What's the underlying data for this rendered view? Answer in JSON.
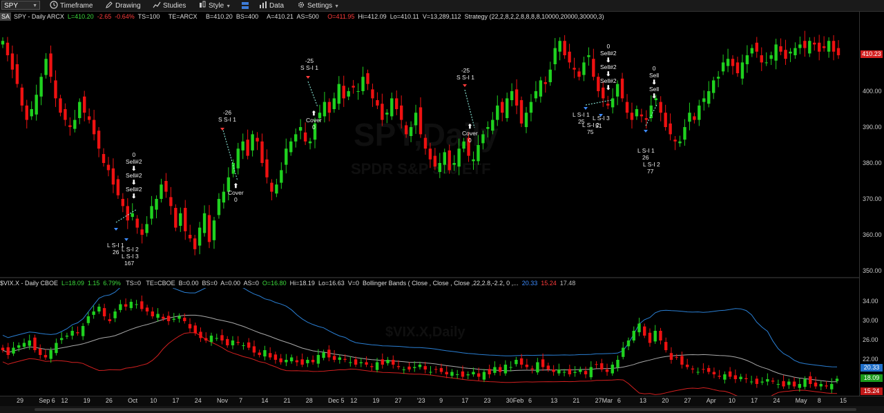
{
  "toolbar": {
    "symbol": "SPY",
    "timeframe": "Timeframe",
    "drawing": "Drawing",
    "studies": "Studies",
    "style": "Style",
    "data": "Data",
    "settings": "Settings"
  },
  "price_header": {
    "badge": "SA",
    "symbol": "SPY - Daily  ARCX",
    "last": "L=410.20",
    "chg": "-2.65",
    "pct": "-0.64%",
    "ts": "TS=100",
    "te": "TE=ARCX",
    "bid": "B=410.20",
    "bs": "BS=400",
    "ask": "A=410.21",
    "as": "AS=500",
    "open": "O=411.95",
    "high": "Hi=412.09",
    "low": "Lo=410.11",
    "vol": "V=13,289,112",
    "strategy": "Strategy (22,2,8,2,2,8,8,8,8,10000,20000,30000,3)"
  },
  "vix_header": {
    "symbol": "$VIX.X - Daily  CBOE",
    "last": "L=18.09",
    "chg": "1.15",
    "pct": "6.79%",
    "ts": "TS=0",
    "te": "TE=CBOE",
    "bid": "B=0.00",
    "bs": "BS=0",
    "ask": "A=0.00",
    "as": "AS=0",
    "open": "O=16.80",
    "high": "Hi=18.19",
    "low": "Lo=16.63",
    "vol": "V=0",
    "study": "Bollinger Bands ( Close , Close , Close ,22,2.8,-2.2, 0 ,...",
    "bb_upper": "20.33",
    "bb_lower": "15.24",
    "bb_mid": "17.48"
  },
  "watermarks": {
    "spy_title": "SPY,Daily",
    "spy_sub": "SPDR S&P 500 ETF",
    "vix_title": "$VIX.X,Daily"
  },
  "price_axis": [
    "400.00",
    "390.00",
    "380.00",
    "370.00",
    "360.00",
    "350.00"
  ],
  "price_tag": "410.23",
  "vix_axis": [
    "34.00",
    "30.00",
    "26.00",
    "22.00"
  ],
  "vix_tags": {
    "upper": "20.33",
    "last": "18.09",
    "lower": "15.24"
  },
  "date_axis": [
    "29",
    "Sep 6",
    "12",
    "19",
    "26",
    "Oct",
    "10",
    "17",
    "24",
    "Nov",
    "7",
    "14",
    "21",
    "28",
    "Dec 5",
    "12",
    "19",
    "27",
    "'23",
    "9",
    "17",
    "23",
    "30Feb",
    "6",
    "13",
    "21",
    "27Mar",
    "6",
    "13",
    "20",
    "27",
    "Apr",
    "10",
    "17",
    "24",
    "May",
    "8",
    "15"
  ],
  "annotations": {
    "a1": [
      "0",
      "Sell#2",
      "Sell#2",
      "Sell#2"
    ],
    "a1b": [
      "L S-I 1",
      "26",
      "L S-I 2",
      "83",
      "L S-I 3",
      "167"
    ],
    "a2": [
      "-26",
      "S S-I 1"
    ],
    "a2b": [
      "Cover",
      "0"
    ],
    "a3": [
      "-25",
      "S S-I 1"
    ],
    "a3b": [
      "Cover",
      "0"
    ],
    "a4": [
      "-25",
      "S S-I 1"
    ],
    "a4b": [
      "Cover",
      "0"
    ],
    "a5": [
      "0",
      "Sell#2",
      "Sell#2",
      "Sell#2"
    ],
    "a5b": [
      "L S-I 1",
      "25",
      "L S-I 3",
      "L S-I 2",
      "51",
      "75"
    ],
    "a6": [
      "0",
      "Sell",
      "Sell"
    ],
    "a6b": [
      "L S-I 1",
      "26",
      "L S-I 2",
      "77"
    ]
  },
  "colors": {
    "up": "#1fd11f",
    "down": "#ee1111",
    "bb_upper": "#2a7fd4",
    "bb_lower": "#d42020",
    "bb_mid": "#aaaaaa"
  },
  "spy_closes": [
    414,
    410,
    406,
    402,
    396,
    392,
    395,
    399,
    404,
    409,
    404,
    398,
    394,
    392,
    390,
    392,
    397,
    394,
    392,
    388,
    384,
    380,
    378,
    374,
    371,
    368,
    364,
    366,
    362,
    360,
    363,
    368,
    370,
    374,
    372,
    368,
    362,
    366,
    361,
    359,
    356,
    362,
    366,
    358,
    364,
    370,
    372,
    376,
    380,
    384,
    386,
    382,
    388,
    386,
    380,
    376,
    372,
    374,
    378,
    384,
    386,
    388,
    390,
    386,
    386,
    391,
    394,
    397,
    394,
    398,
    402,
    398,
    400,
    401,
    400,
    404,
    402,
    398,
    396,
    392,
    394,
    398,
    395,
    392,
    388,
    390,
    394,
    388,
    384,
    381,
    379,
    380,
    383,
    378,
    380,
    384,
    386,
    382,
    381,
    385,
    388,
    390,
    392,
    396,
    394,
    398,
    400,
    396,
    391,
    394,
    397,
    400,
    403,
    402,
    406,
    412,
    414,
    410,
    408,
    406,
    404,
    408,
    410,
    404,
    400,
    398,
    396,
    398,
    402,
    398,
    394,
    392,
    395,
    393,
    392,
    396,
    398,
    394,
    390,
    388,
    386,
    386,
    390,
    394,
    392,
    396,
    398,
    400,
    403,
    404,
    408,
    409,
    407,
    405,
    408,
    410,
    412,
    411,
    408,
    408,
    410,
    413,
    411,
    409,
    411,
    412,
    413,
    412,
    414,
    413,
    411,
    412,
    414,
    411,
    410
  ],
  "vix_closes": [
    24,
    23,
    24.5,
    25,
    25.5,
    26,
    24,
    23,
    22.5,
    24,
    25.5,
    26.5,
    27,
    28,
    27.5,
    29,
    31,
    32,
    33,
    31,
    30,
    32,
    33.5,
    33,
    34,
    33.5,
    32.5,
    32,
    31,
    31.5,
    30.5,
    30,
    30.5,
    31,
    30,
    28.5,
    27.5,
    26.5,
    26,
    27,
    26.5,
    26,
    25,
    26,
    25.5,
    25,
    24.5,
    23.5,
    23,
    24,
    22.5,
    22,
    21.5,
    22,
    22.5,
    21.5,
    21,
    22,
    21.5,
    23,
    23.5,
    22.5,
    22,
    22.5,
    22,
    21.5,
    21,
    21.5,
    21,
    20.5,
    21.5,
    21,
    22,
    21,
    20.5,
    20,
    20,
    20.5,
    21,
    20,
    19.5,
    20,
    19.5,
    19,
    19.5,
    19,
    18.5,
    19,
    19.5,
    18.5,
    19.5,
    19,
    20.5,
    19.5,
    21,
    20.5,
    22,
    21,
    20.5,
    20,
    21.5,
    20.5,
    20,
    19.5,
    20,
    19.5,
    19,
    19.5,
    20,
    19,
    20.5,
    21,
    20,
    19.5,
    21,
    22,
    24.5,
    26,
    28,
    29.5,
    27,
    25.5,
    28,
    26,
    24,
    22,
    22.5,
    21,
    20.5,
    20,
    19.5,
    20,
    19.5,
    19,
    18.5,
    19,
    18.5,
    18,
    18.5,
    18,
    17.5,
    17,
    17.5,
    18,
    17.5,
    17,
    16.5,
    17.5,
    16.5,
    17,
    18,
    17,
    16.5,
    17,
    16.5,
    17,
    18.09
  ]
}
